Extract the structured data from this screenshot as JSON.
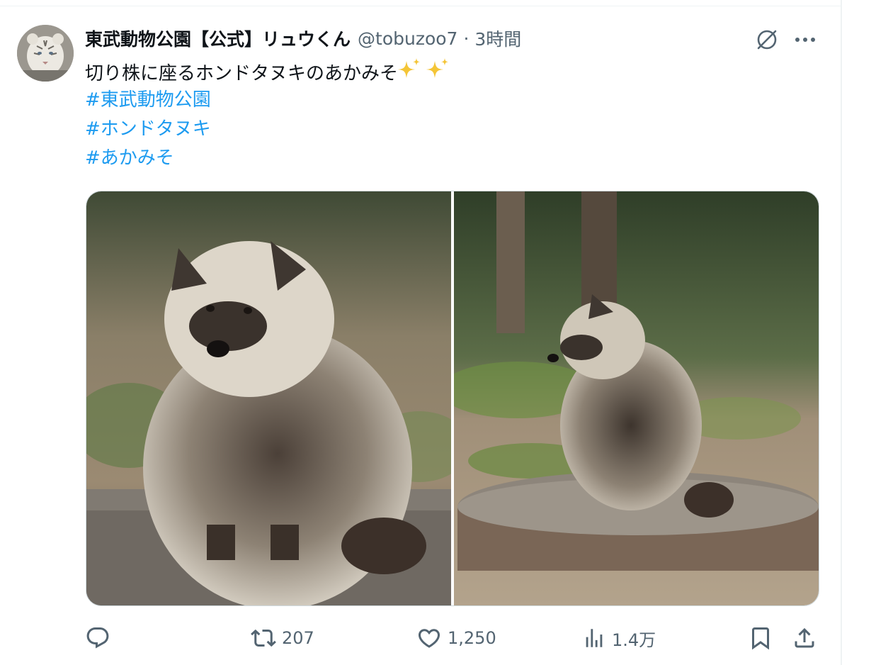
{
  "tweet": {
    "display_name": "東武動物公園【公式】リュウくん",
    "handle": "@tobuzoo7",
    "separator": "·",
    "time": "3時間",
    "text_main": "切り株に座るホンドタヌキのあかみそ",
    "hashtags": [
      "#東武動物公園",
      "#ホンドタヌキ",
      "#あかみそ"
    ],
    "icons": {
      "avatar": "white-tiger-avatar",
      "grok": "grok-icon",
      "more": "more-icon",
      "sparkles": "sparkles-emoji"
    }
  },
  "media": {
    "photos": [
      {
        "name": "raccoon-dog-front-photo"
      },
      {
        "name": "raccoon-dog-side-photo"
      }
    ]
  },
  "actions": {
    "reply": {
      "icon": "reply-icon",
      "count": ""
    },
    "retweet": {
      "icon": "retweet-icon",
      "count": "207"
    },
    "like": {
      "icon": "heart-icon",
      "count": "1,250"
    },
    "views": {
      "icon": "views-icon",
      "count": "1.4万"
    },
    "bookmark": {
      "icon": "bookmark-icon"
    },
    "share": {
      "icon": "share-icon"
    }
  },
  "colors": {
    "text": "#0f1419",
    "secondary": "#536471",
    "link": "#1d9bf0",
    "border": "#cfd9de"
  }
}
